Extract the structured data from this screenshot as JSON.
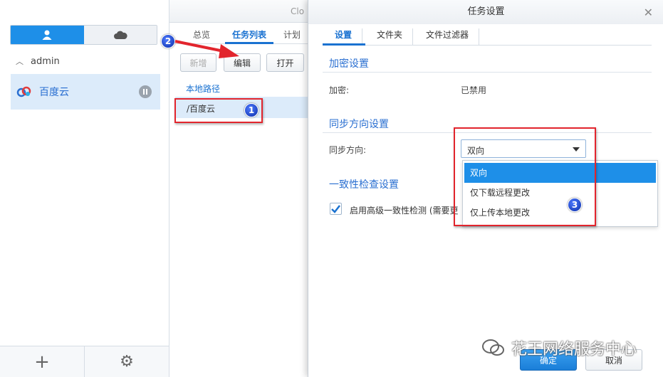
{
  "window": {
    "title_partial": "Clo"
  },
  "sidebar": {
    "account": "admin",
    "connection": "百度云",
    "add_symbol": "+",
    "settings_symbol": "⚙"
  },
  "middle": {
    "tabs": [
      "总览",
      "任务列表",
      "计划"
    ],
    "buttons": {
      "add": "新增",
      "edit": "编辑",
      "open": "打开"
    },
    "column_header": "本地路径",
    "row": "/百度云"
  },
  "dialog": {
    "title": "任务设置",
    "close": "✕",
    "tabs": [
      "设置",
      "文件夹",
      "文件过滤器"
    ],
    "sections": {
      "encryption": {
        "title": "加密设置",
        "label": "加密:",
        "value": "已禁用"
      },
      "sync": {
        "title": "同步方向设置",
        "label": "同步方向:",
        "value": "双向"
      },
      "consistency": {
        "title": "一致性检查设置",
        "checkbox_label": "启用高级一致性检测 (需要更"
      }
    },
    "dropdown_options": [
      "双向",
      "仅下载远程更改",
      "仅上传本地更改"
    ],
    "footer": {
      "ok": "确定",
      "cancel": "取消"
    }
  },
  "annotations": {
    "n1": "1",
    "n2": "2",
    "n3": "3"
  },
  "watermark": "花王网络服务中心",
  "colors": {
    "accent": "#1e8fe8",
    "annotation_red": "#e2252d"
  }
}
